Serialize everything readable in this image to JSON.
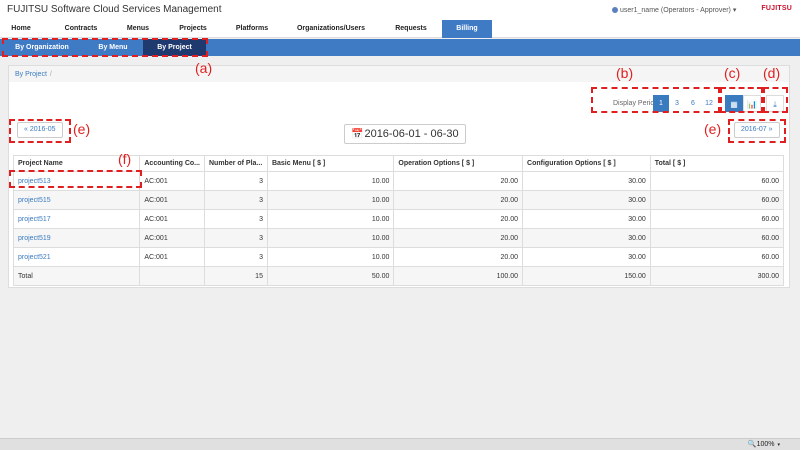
{
  "header": {
    "title": "FUJITSU Software Cloud Services Management",
    "user": "user1_name (Operators - Approver)",
    "user_caret": "▾",
    "brand": "FUJITSU"
  },
  "nav": {
    "tabs": [
      {
        "label": "Home"
      },
      {
        "label": "Contracts"
      },
      {
        "label": "Menus"
      },
      {
        "label": "Projects"
      },
      {
        "label": "Platforms"
      },
      {
        "label": "Organizations/Users"
      },
      {
        "label": "Requests"
      },
      {
        "label": "Billing"
      }
    ]
  },
  "subnav": {
    "tabs": [
      {
        "label": "By Organization"
      },
      {
        "label": "By Menu"
      },
      {
        "label": "By Project"
      }
    ]
  },
  "breadcrumb": {
    "item": "By Project",
    "sep": "/"
  },
  "period": {
    "label": "Display Period",
    "options": [
      "1",
      "3",
      "6",
      "12"
    ],
    "selected": "1"
  },
  "views": {
    "table_icon": "▦",
    "chart_icon": "📊",
    "download_icon": "⤓"
  },
  "navigation": {
    "prev": "« 2016-05",
    "next": "2016-07 »",
    "range": "2016-06-01 - 06-30",
    "calendar_icon": "📅"
  },
  "table": {
    "headers": [
      "Project Name",
      "Accounting Co...",
      "Number of Pla...",
      "Basic Menu [ $ ]",
      "Operation Options [ $ ]",
      "Configuration Options [ $ ]",
      "Total [ $ ]"
    ],
    "rows": [
      [
        "project513",
        "AC:001",
        "3",
        "10.00",
        "20.00",
        "30.00",
        "60.00"
      ],
      [
        "project515",
        "AC:001",
        "3",
        "10.00",
        "20.00",
        "30.00",
        "60.00"
      ],
      [
        "project517",
        "AC:001",
        "3",
        "10.00",
        "20.00",
        "30.00",
        "60.00"
      ],
      [
        "project519",
        "AC:001",
        "3",
        "10.00",
        "20.00",
        "30.00",
        "60.00"
      ],
      [
        "project521",
        "AC:001",
        "3",
        "10.00",
        "20.00",
        "30.00",
        "60.00"
      ]
    ],
    "total": [
      "Total",
      "",
      "15",
      "50.00",
      "100.00",
      "150.00",
      "300.00"
    ]
  },
  "annotations": {
    "a": "(a)",
    "b": "(b)",
    "c": "(c)",
    "d": "(d)",
    "e": "(e)",
    "f": "(f)"
  },
  "status": {
    "zoom": "100%",
    "zoom_icon": "🔍",
    "zoom_caret": "▾"
  }
}
